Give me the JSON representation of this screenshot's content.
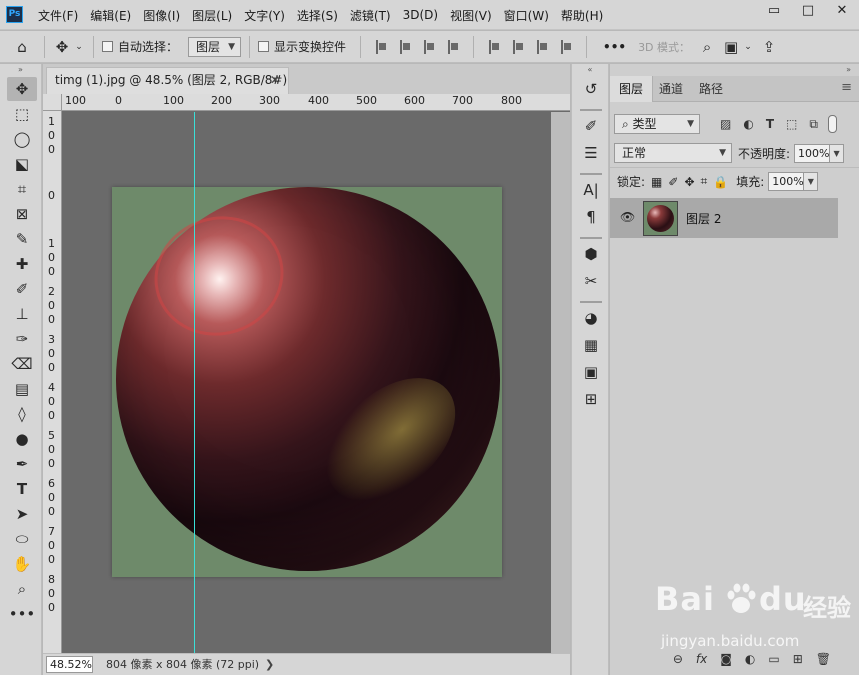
{
  "app": {
    "logo": "Ps"
  },
  "menu": [
    "文件(F)",
    "编辑(E)",
    "图像(I)",
    "图层(L)",
    "文字(Y)",
    "选择(S)",
    "滤镜(T)",
    "3D(D)",
    "视图(V)",
    "窗口(W)",
    "帮助(H)"
  ],
  "window_controls": {
    "minimize": "▭",
    "maximize": "□",
    "close": "✕"
  },
  "options": {
    "auto_select_label": "自动选择：",
    "auto_select_value": "图层",
    "show_transform_label": "显示变换控件",
    "more": "•••",
    "mode_3d": "3D 模式："
  },
  "document": {
    "tab_title": "timg (1).jpg @ 48.5% (图层 2, RGB/8#) *",
    "tab_close": "✕",
    "ruler_top_labels": [
      "100",
      "0",
      "100",
      "200",
      "300",
      "400",
      "500",
      "600",
      "700",
      "800"
    ],
    "ruler_left_labels": [
      "1",
      "0",
      "0",
      "0",
      "1",
      "0",
      "0",
      "2",
      "0",
      "0",
      "3",
      "0",
      "0",
      "4",
      "0",
      "0",
      "5",
      "0",
      "0",
      "6",
      "0",
      "0",
      "7",
      "0",
      "0",
      "8",
      "0",
      "0"
    ],
    "zoom": "48.52%",
    "status_info": "804 像素 x 804 像素 (72 ppi)",
    "status_more": "❯"
  },
  "layers_panel": {
    "tabs": [
      "图层",
      "通道",
      "路径"
    ],
    "menu_icon": "≡",
    "filter_kind": "类型",
    "blend_mode": "正常",
    "opacity_label": "不透明度:",
    "opacity_value": "100%",
    "lock_label": "锁定:",
    "fill_label": "填充:",
    "fill_value": "100%",
    "layers": [
      {
        "name": "图层 2",
        "visible": true
      }
    ],
    "bottom_icons": [
      "⊖",
      "fx",
      "◙",
      "◐",
      "▭",
      "⊞",
      "🗑"
    ]
  },
  "watermark": {
    "brand": "Bai",
    "brand_end": "du",
    "cn": "经验",
    "url": "jingyan.baidu.com"
  },
  "colors": {
    "guide": "#3ae0d8",
    "canvas_bg": "#6e8a6a",
    "workspace": "#6a6a6a"
  }
}
